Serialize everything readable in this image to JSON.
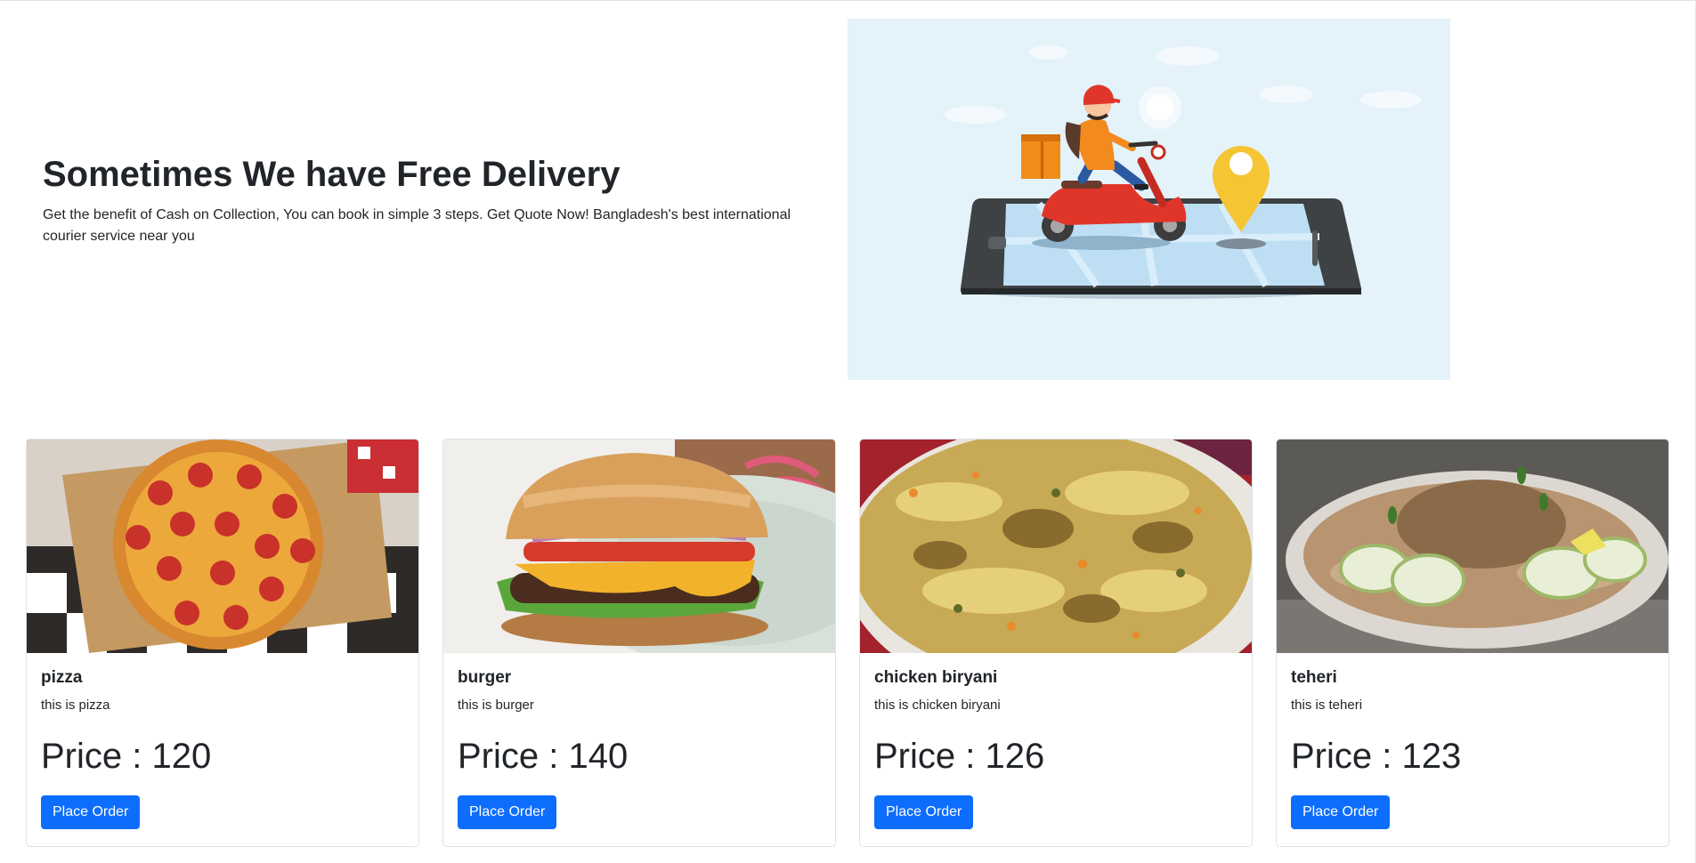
{
  "hero": {
    "title": "Sometimes We have Free Delivery",
    "description": "Get the benefit of Cash on Collection, You can book in simple 3 steps. Get Quote Now! Bangladesh's best international courier service near you",
    "illustration": "delivery-scooter-on-phone-illustration"
  },
  "colors": {
    "primary_button": "#0d6efd",
    "hero_art_bg": "#e4f2fa",
    "text": "#212529"
  },
  "products": [
    {
      "name": "pizza",
      "description": "this is pizza",
      "price": "Price : 120",
      "button": "Place Order",
      "image": "pizza-photo"
    },
    {
      "name": "burger",
      "description": "this is burger",
      "price": "Price : 140",
      "button": "Place Order",
      "image": "burger-photo"
    },
    {
      "name": "chicken biryani",
      "description": "this is chicken biryani",
      "price": "Price : 126",
      "button": "Place Order",
      "image": "chicken-biryani-photo"
    },
    {
      "name": "teheri",
      "description": "this is teheri",
      "price": "Price : 123",
      "button": "Place Order",
      "image": "teheri-photo"
    }
  ]
}
